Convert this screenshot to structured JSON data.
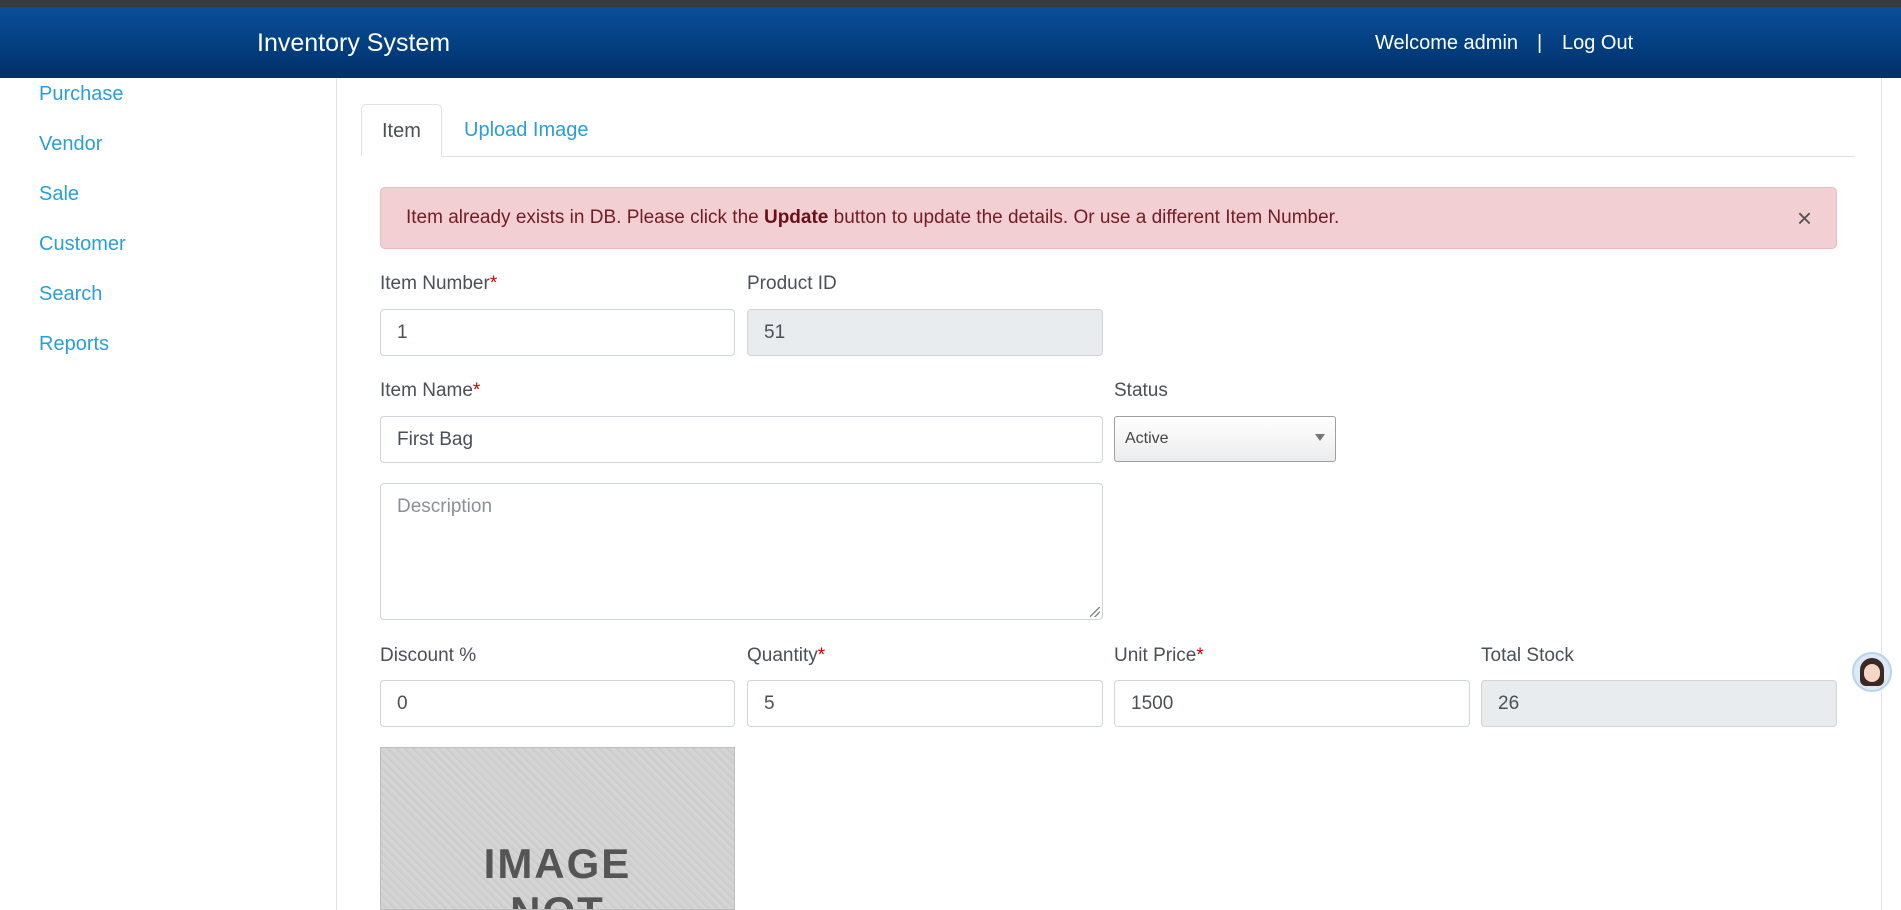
{
  "navbar": {
    "brand": "Inventory System",
    "welcome": "Welcome admin",
    "separator": "|",
    "logout": "Log Out",
    "color": "#033f80"
  },
  "sidebar": {
    "items": [
      {
        "label": "Purchase"
      },
      {
        "label": "Vendor"
      },
      {
        "label": "Sale"
      },
      {
        "label": "Customer"
      },
      {
        "label": "Search"
      },
      {
        "label": "Reports"
      }
    ],
    "link_color": "#2a9fd6"
  },
  "tabs": [
    {
      "label": "Item",
      "active": true
    },
    {
      "label": "Upload Image",
      "active": false
    }
  ],
  "alert": {
    "text_before": "Item already exists in DB. Please click the ",
    "bold": "Update",
    "text_after": " button to update the details. Or use a different Item Number.",
    "close": "×",
    "background": "#f2cfd3"
  },
  "form": {
    "item_number": {
      "label": "Item Number",
      "required": "*",
      "value": "1"
    },
    "product_id": {
      "label": "Product ID",
      "value": "51"
    },
    "item_name": {
      "label": "Item Name",
      "required": "*",
      "value": "First Bag"
    },
    "status": {
      "label": "Status",
      "value": "Active"
    },
    "description": {
      "placeholder": "Description"
    },
    "discount": {
      "label": "Discount %",
      "value": "0"
    },
    "quantity": {
      "label": "Quantity",
      "required": "*",
      "value": "5"
    },
    "unit_price": {
      "label": "Unit Price",
      "required": "*",
      "value": "1500"
    },
    "total_stock": {
      "label": "Total Stock",
      "value": "26"
    }
  },
  "image_placeholder": {
    "line1": "IMAGE",
    "line2": "NOT"
  }
}
